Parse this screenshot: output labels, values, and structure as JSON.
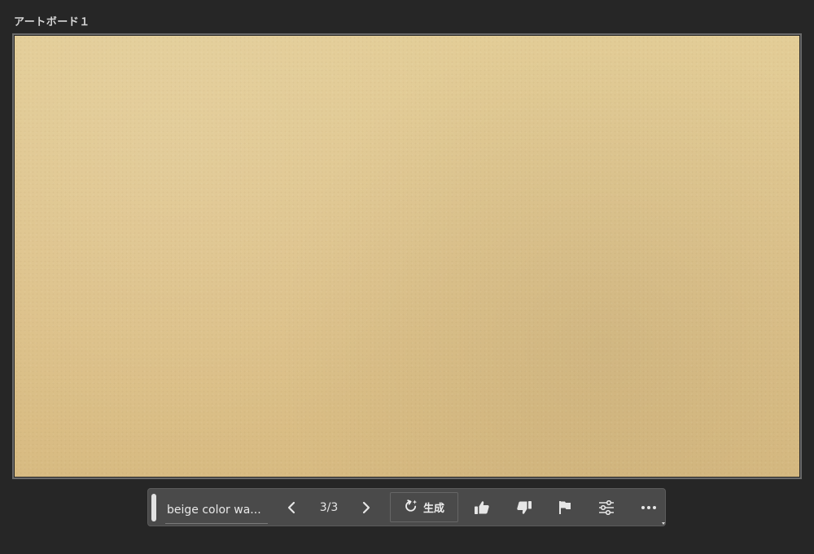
{
  "artboard": {
    "title": "アートボード１",
    "fill_color": "#dfc58f"
  },
  "toolbar": {
    "prompt_value": "beige color wa...",
    "page_indicator": "3/3",
    "generate_label": "生成",
    "icons": {
      "prev": "chevron-left-icon",
      "next": "chevron-right-icon",
      "generate": "regenerate-sparkle-icon",
      "like": "thumbs-up-icon",
      "dislike": "thumbs-down-icon",
      "flag": "flag-icon",
      "settings": "sliders-icon",
      "more": "more-horizontal-icon"
    }
  }
}
